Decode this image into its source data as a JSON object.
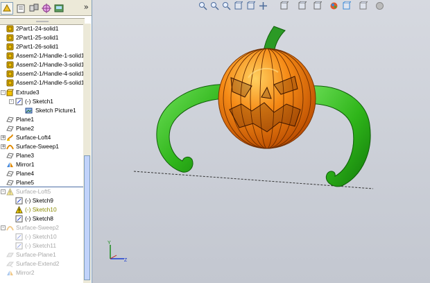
{
  "panel_toolbar": {
    "buttons": [
      "feature-manager-icon",
      "property-manager-icon",
      "configuration-manager-icon",
      "dimxpert-icon",
      "display-manager-icon"
    ],
    "expand_glyph": "»"
  },
  "tree": [
    {
      "label": "2Part1-24-solid1",
      "icon": "part-icon",
      "state": "normal"
    },
    {
      "label": "2Part1-25-solid1",
      "icon": "part-icon",
      "state": "normal"
    },
    {
      "label": "2Part1-26-solid1",
      "icon": "part-icon",
      "state": "normal"
    },
    {
      "label": "Assem2-1/Handle-1-solid1",
      "icon": "part-icon",
      "state": "normal"
    },
    {
      "label": "Assem2-1/Handle-3-solid1",
      "icon": "part-icon",
      "state": "normal"
    },
    {
      "label": "Assem2-1/Handle-4-solid1",
      "icon": "part-icon",
      "state": "normal"
    },
    {
      "label": "Assem2-1/Handle-5-solid1",
      "icon": "part-icon",
      "state": "normal"
    },
    {
      "label": "Extrude3",
      "icon": "extrude-icon",
      "state": "normal",
      "expander": "-"
    },
    {
      "label": "(-) Sketch1",
      "icon": "sketch-icon",
      "state": "normal",
      "expander": "-"
    },
    {
      "label": "Sketch Picture1",
      "icon": "sketch-picture-icon",
      "state": "normal"
    },
    {
      "label": "Plane1",
      "icon": "plane-icon",
      "state": "normal"
    },
    {
      "label": "Plane2",
      "icon": "plane-icon",
      "state": "normal"
    },
    {
      "label": "Surface-Loft4",
      "icon": "surface-loft-icon",
      "state": "normal",
      "expander": "+"
    },
    {
      "label": "Surface-Sweep1",
      "icon": "surface-sweep-icon",
      "state": "normal",
      "expander": "+"
    },
    {
      "label": "Plane3",
      "icon": "plane-icon",
      "state": "normal"
    },
    {
      "label": "Mirror1",
      "icon": "mirror-icon",
      "state": "normal"
    },
    {
      "label": "Plane4",
      "icon": "plane-icon",
      "state": "normal"
    },
    {
      "label": "Plane5",
      "icon": "plane-icon",
      "state": "normal"
    },
    {
      "label": "Surface-Loft5",
      "icon": "warning-icon",
      "state": "dim",
      "expander": "-"
    },
    {
      "label": "(-) Sketch9",
      "icon": "sketch-icon",
      "state": "normal"
    },
    {
      "label": "(-) Sketch10",
      "icon": "warning-icon",
      "state": "warn"
    },
    {
      "label": "(-) Sketch8",
      "icon": "sketch-icon",
      "state": "normal"
    },
    {
      "label": "Surface-Sweep2",
      "icon": "surface-sweep-icon",
      "state": "dim",
      "expander": "-"
    },
    {
      "label": "(-) Sketch10",
      "icon": "sketch-icon",
      "state": "dim"
    },
    {
      "label": "(-) Sketch11",
      "icon": "sketch-icon",
      "state": "dim"
    },
    {
      "label": "Surface-Plane1",
      "icon": "surface-plane-icon",
      "state": "dim"
    },
    {
      "label": "Surface-Extend2",
      "icon": "surface-extend-icon",
      "state": "dim"
    },
    {
      "label": "Mirror2",
      "icon": "mirror-icon",
      "state": "dim"
    }
  ],
  "view_toolbar": [
    "zoom-to-fit-icon",
    "zoom-area-icon",
    "zoom-in-out-icon",
    "previous-view-icon",
    "rotate-view-icon",
    "pan-icon",
    "view-orientation-icon",
    "display-style-icon",
    "hide-show-icon",
    "edit-appearance-icon",
    "apply-scene-icon",
    "view-settings-icon",
    "realview-icon"
  ],
  "colors": {
    "pumpkin": "#f07a10",
    "pumpkin_dark": "#b84a00",
    "handle": "#2fb51a",
    "handle_dark": "#127a0a",
    "stem": "#2b9a25",
    "background": "#c9ccd4"
  },
  "triad": {
    "y_label": "Y",
    "z_label": "Z"
  }
}
